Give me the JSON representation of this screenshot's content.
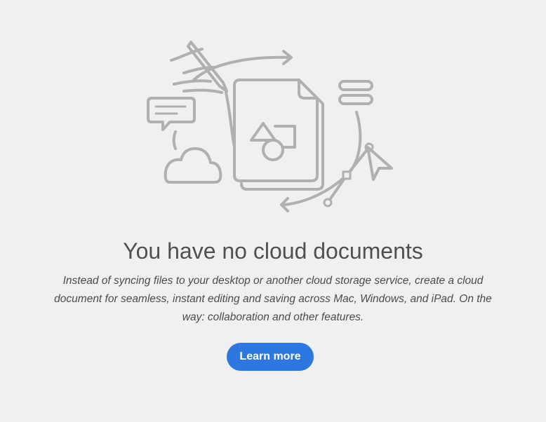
{
  "empty_state": {
    "title": "You have no cloud documents",
    "description": "Instead of syncing files to your desktop or another cloud storage service, create a cloud document for seamless, instant editing and saving across Mac, Windows, and iPad. On the way: collaboration and other features.",
    "learn_more_label": "Learn more"
  },
  "illustration": {
    "icons": [
      "pen-icon",
      "chat-bubble-icon",
      "cloud-icon",
      "document-stack-icon",
      "shapes-icon",
      "menu-lines-icon",
      "cursor-arrow-icon",
      "bezier-path-icon",
      "arrow-right-icon",
      "arrow-left-icon"
    ],
    "stroke_color": "#b0b0b0"
  },
  "colors": {
    "background": "#f0f0f0",
    "title": "#505050",
    "text": "#4b4b4b",
    "accent": "#2c78e0"
  }
}
